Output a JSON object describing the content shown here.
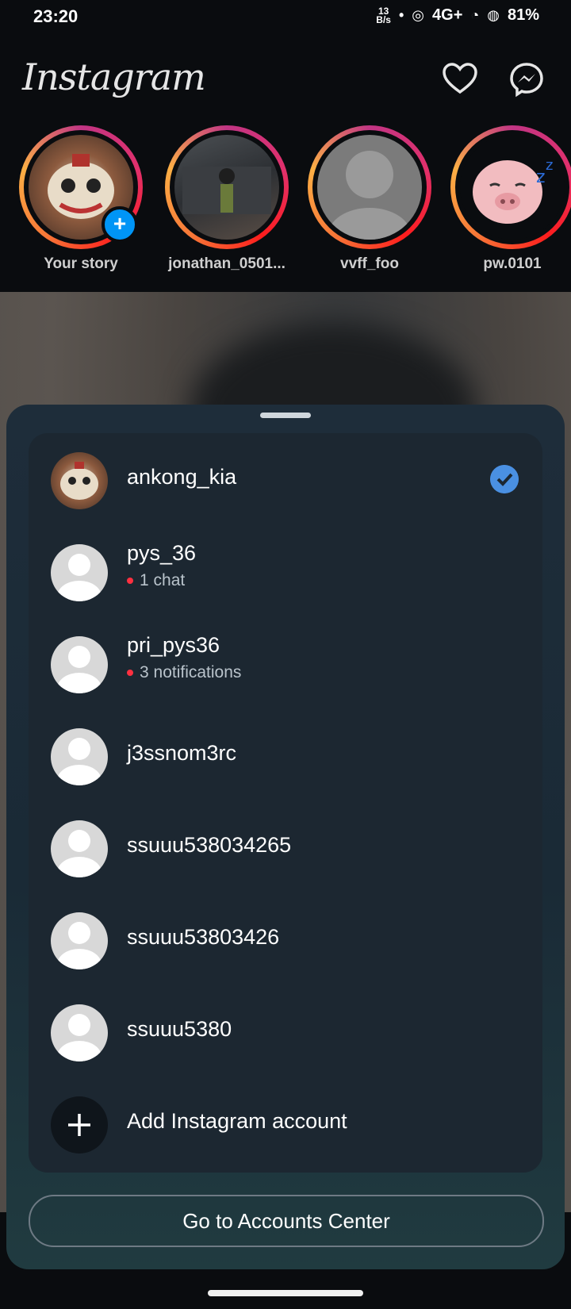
{
  "status_bar": {
    "time": "23:20",
    "speed": "13",
    "speed_unit": "B/s",
    "network": "4G+",
    "battery": "81%"
  },
  "header": {
    "logo": "Instagram",
    "icons": [
      "heart-icon",
      "messenger-icon"
    ]
  },
  "stories": [
    {
      "name": "Your story"
    },
    {
      "name": "jonathan_0501..."
    },
    {
      "name": "vvff_foo"
    },
    {
      "name": "pw.0101"
    }
  ],
  "account_switcher": {
    "accounts": [
      {
        "username": "ankong_kia",
        "selected": true
      },
      {
        "username": "pys_36",
        "sub": "1 chat"
      },
      {
        "username": "pri_pys36",
        "sub": "3 notifications"
      },
      {
        "username": "j3ssnom3rc"
      },
      {
        "username": "ssuuu538034265"
      },
      {
        "username": "ssuuu53803426"
      },
      {
        "username": "ssuuu5380"
      }
    ],
    "add_account": "Add Instagram account",
    "accounts_center": "Go to Accounts Center"
  },
  "colors": {
    "accent": "#4a90e2",
    "notification_dot": "#ff3040",
    "sheet": "#1e2d3a",
    "card": "#1c2731"
  }
}
